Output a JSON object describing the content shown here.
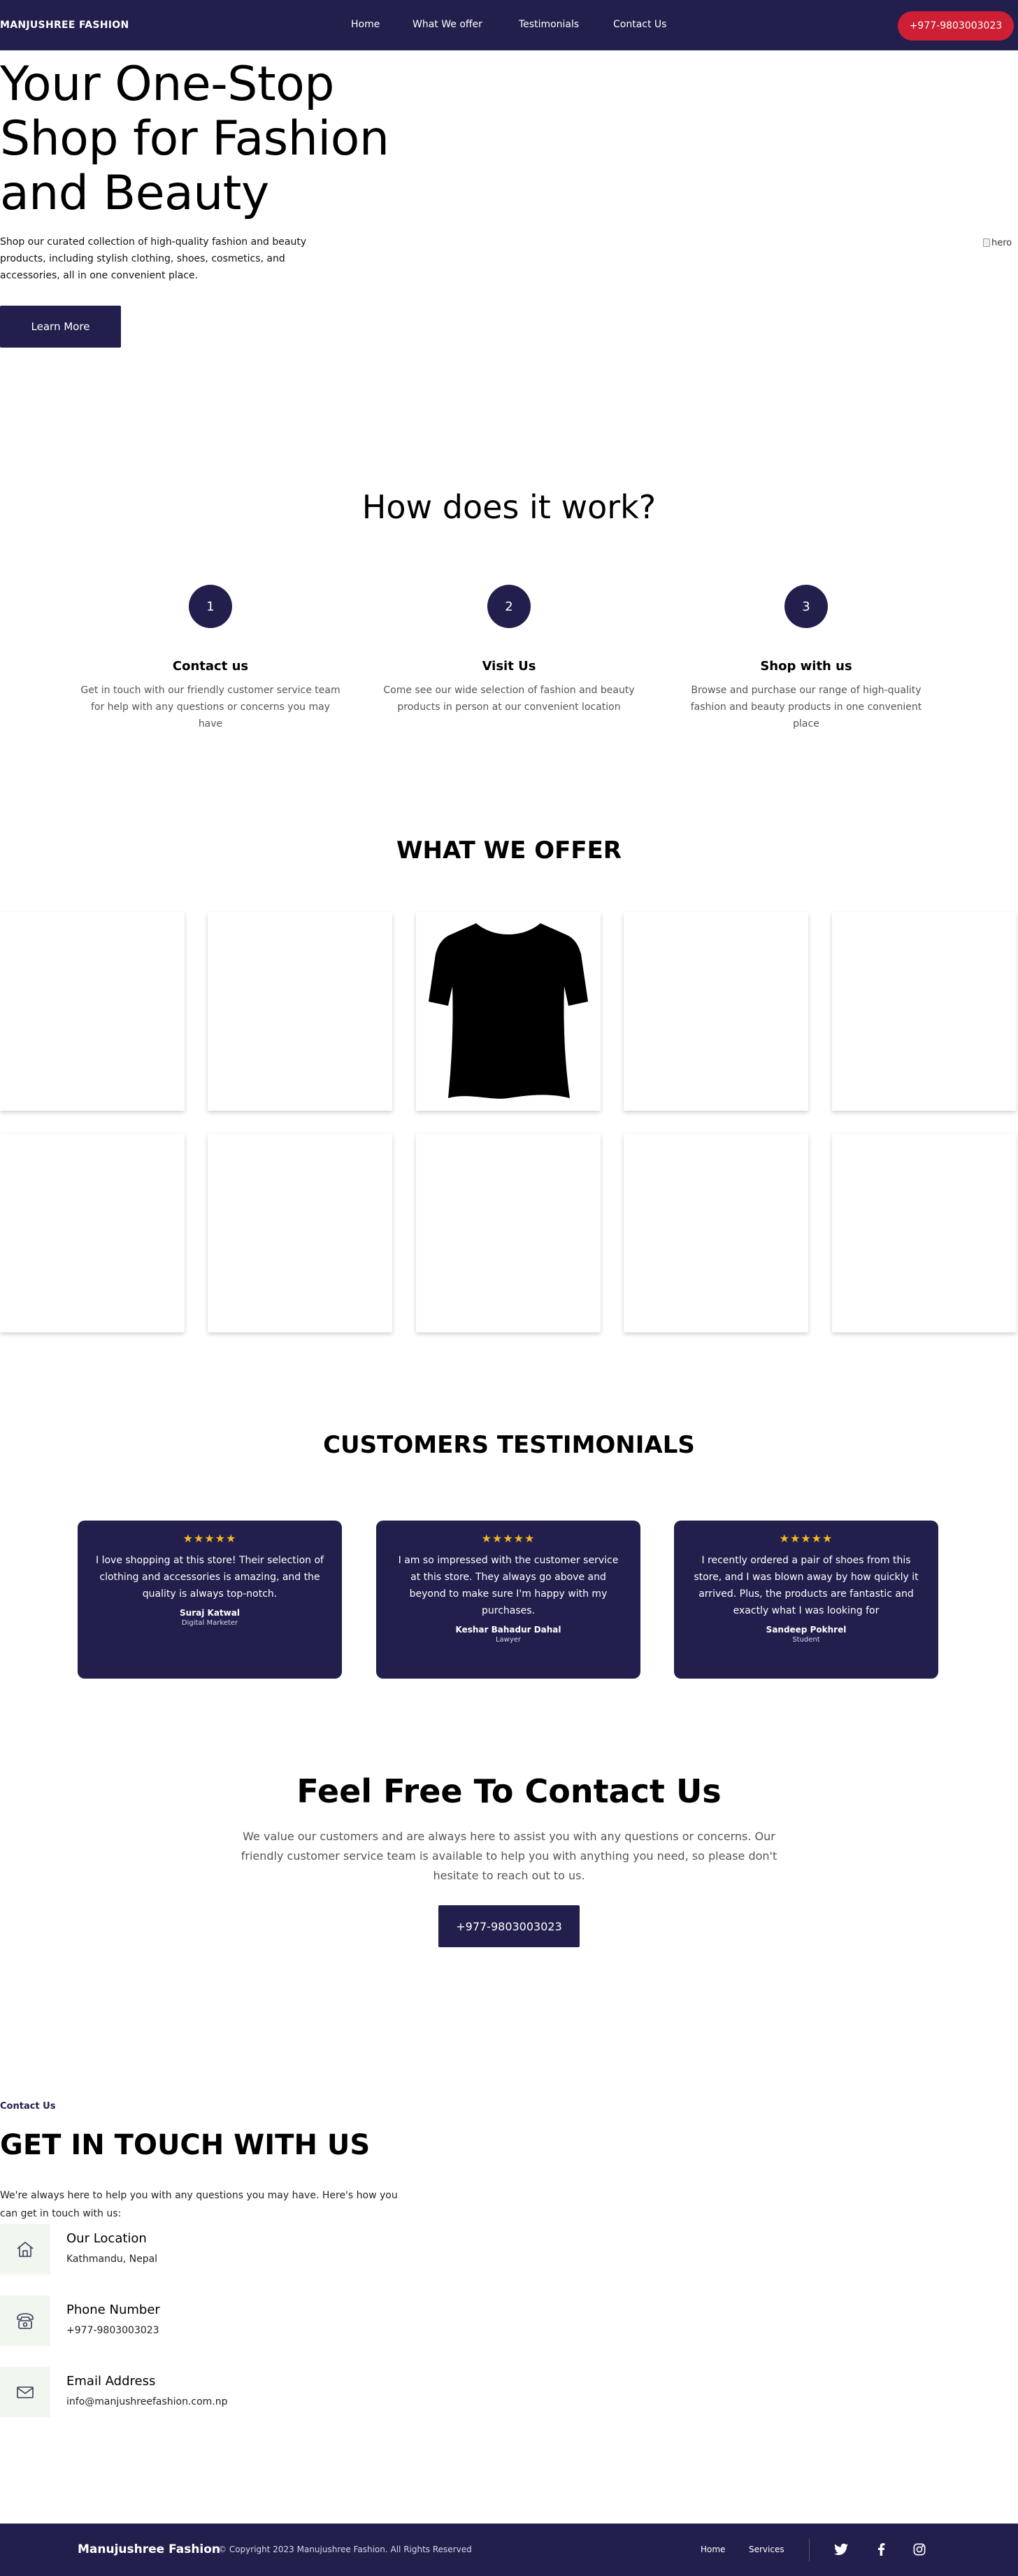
{
  "nav": {
    "brand": "MANJUSHREE FASHION",
    "links": [
      "Home",
      "What We offer",
      "Testimonials",
      "Contact Us"
    ],
    "phone": "+977-9803003023"
  },
  "hero": {
    "title": "Your One-Stop Shop for Fashion and Beauty",
    "description": "Shop our curated collection of high-quality fashion and beauty products, including stylish clothing, shoes, cosmetics, and accessories, all in one convenient place.",
    "button": "Learn More",
    "image_alt": "hero"
  },
  "how": {
    "title": "How does it work?",
    "steps": [
      {
        "number": "1",
        "title": "Contact us",
        "desc": "Get in touch with our friendly customer service team for help with any questions or concerns you may have"
      },
      {
        "number": "2",
        "title": "Visit Us",
        "desc": "Come see our wide selection of fashion and beauty products in person at our convenient location"
      },
      {
        "number": "3",
        "title": "Shop with us",
        "desc": "Browse and purchase our range of high-quality fashion and beauty products in one convenient place"
      }
    ]
  },
  "offer": {
    "title": "WHAT WE OFFER",
    "card_count": 10
  },
  "testimonials": {
    "title": "CUSTOMERS TESTIMONIALS",
    "items": [
      {
        "stars": "★★★★★",
        "quote": "I love shopping at this store! Their selection of clothing and accessories is amazing, and the quality is always top-notch.",
        "name": "Suraj Katwal",
        "role": "Digital Marketer"
      },
      {
        "stars": "★★★★★",
        "quote": "I am so impressed with the customer service at this store. They always go above and beyond to make sure I'm happy with my purchases.",
        "name": "Keshar Bahadur Dahal",
        "role": "Lawyer"
      },
      {
        "stars": "★★★★★",
        "quote": "I recently ordered a pair of shoes from this store, and I was blown away by how quickly it arrived. Plus, the products are fantastic and exactly what I was looking for",
        "name": "Sandeep Pokhrel",
        "role": "Student"
      }
    ]
  },
  "cta": {
    "title": "Feel Free To Contact Us",
    "text": "We value our customers and are always here to assist you with any questions or concerns. Our friendly customer service team is available to help you with anything you need, so please don't hesitate to reach out to us.",
    "button": "+977-9803003023"
  },
  "contact": {
    "eyebrow": "Contact Us",
    "title": "GET IN TOUCH WITH US",
    "desc": "We're always here to help you with any questions you may have. Here's how you can get in touch with us:",
    "items": [
      {
        "icon": "home-icon",
        "title": "Our Location",
        "value": "Kathmandu, Nepal"
      },
      {
        "icon": "phone-icon",
        "title": "Phone Number",
        "value": "+977-9803003023"
      },
      {
        "icon": "mail-icon",
        "title": "Email Address",
        "value": "info@manjushreefashion.com.np"
      }
    ]
  },
  "footer": {
    "brand": "Manujushree Fashion",
    "copyright": "© Copyright 2023 Manujushree Fashion. All Rights Reserved",
    "links": [
      "Home",
      "Services"
    ],
    "social": [
      "twitter-icon",
      "facebook-icon",
      "instagram-icon"
    ]
  },
  "colors": {
    "primary": "#221f4d",
    "accent_red": "#cf1f34",
    "star": "#f5b91f",
    "icon_bg": "#f1f6ef"
  }
}
